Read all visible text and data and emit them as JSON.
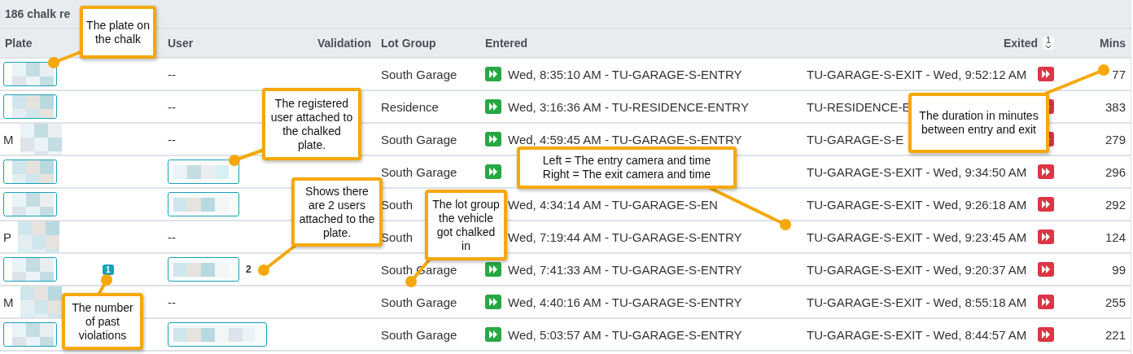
{
  "title": "186 chalk re",
  "columns": [
    {
      "label": "Plate"
    },
    {
      "label": "User"
    },
    {
      "label": "Validation"
    },
    {
      "label": "Lot Group"
    },
    {
      "label": "Entered"
    },
    {
      "label": "Exited",
      "sort_order": "1"
    },
    {
      "label": "Mins"
    }
  ],
  "rows": [
    {
      "plate": {
        "kind": "button"
      },
      "user": {
        "kind": "none",
        "text": "--"
      },
      "lot_group": "South Garage",
      "entered": "Wed, 8:35:10 AM - TU-GARAGE-S-ENTRY",
      "exited": "TU-GARAGE-S-EXIT - Wed, 9:52:12 AM",
      "mins": "77"
    },
    {
      "plate": {
        "kind": "button"
      },
      "user": {
        "kind": "none",
        "text": "--"
      },
      "lot_group": "Residence",
      "entered": "Wed, 3:16:36 AM - TU-RESIDENCE-ENTRY",
      "exited": "TU-RESIDENCE-E",
      "mins": "383"
    },
    {
      "plate": {
        "kind": "text",
        "text": "M"
      },
      "user": {
        "kind": "none",
        "text": "--"
      },
      "lot_group": "South Garage",
      "entered": "Wed, 4:59:45 AM - TU-GARAGE-S-ENTRY",
      "exited": "TU-GARAGE-S-E",
      "mins": "279"
    },
    {
      "plate": {
        "kind": "button"
      },
      "user": {
        "kind": "button"
      },
      "lot_group": "South Garage",
      "exited": "TU-GARAGE-S-EXIT - Wed, 9:34:50 AM",
      "mins": "296"
    },
    {
      "plate": {
        "kind": "button"
      },
      "user": {
        "kind": "button"
      },
      "lot_group": "South",
      "entry_icon": false,
      "entered": "Wed, 4:34:14 AM - TU-GARAGE-S-EN",
      "exited": "TU-GARAGE-S-EXIT - Wed, 9:26:18 AM",
      "mins": "292"
    },
    {
      "plate": {
        "kind": "text",
        "text": "P"
      },
      "user": {
        "kind": "none",
        "text": "--"
      },
      "lot_group": "South",
      "entry_icon": false,
      "entered": "Wed, 7:19:44 AM - TU-GARAGE-S-ENTRY",
      "exited": "TU-GARAGE-S-EXIT - Wed, 9:23:45 AM",
      "mins": "124"
    },
    {
      "plate": {
        "kind": "button"
      },
      "violations": "1",
      "user": {
        "kind": "button",
        "count": "2"
      },
      "lot_group": "South Garage",
      "entered": "Wed, 7:41:33 AM - TU-GARAGE-S-ENTRY",
      "exited": "TU-GARAGE-S-EXIT - Wed, 9:20:37 AM",
      "mins": "99"
    },
    {
      "plate": {
        "kind": "text",
        "text": "M"
      },
      "user": {
        "kind": "none",
        "text": "--"
      },
      "lot_group": "South Garage",
      "entered": "Wed, 4:40:16 AM - TU-GARAGE-S-ENTRY",
      "exited": "TU-GARAGE-S-EXIT - Wed, 8:55:18 AM",
      "mins": "255"
    },
    {
      "plate": {
        "kind": "button"
      },
      "user": {
        "kind": "button"
      },
      "lot_group": "South Garage",
      "entered": "Wed, 5:03:57 AM - TU-GARAGE-S-ENTRY",
      "exited": "TU-GARAGE-S-EXIT - Wed, 8:44:57 AM",
      "mins": "221"
    }
  ],
  "callouts": [
    {
      "text": "The plate on the chalk"
    },
    {
      "text": "The registered user attached to the chalked plate."
    },
    {
      "text": "Shows there are 2 users attached to the plate."
    },
    {
      "text": "The number of past violations"
    },
    {
      "text": "The lot group the vehicle got chalked in"
    },
    {
      "text": "Left = The entry camera and time\nRight = The exit camera and time"
    },
    {
      "text": "The duration in minutes between entry and exit"
    }
  ]
}
